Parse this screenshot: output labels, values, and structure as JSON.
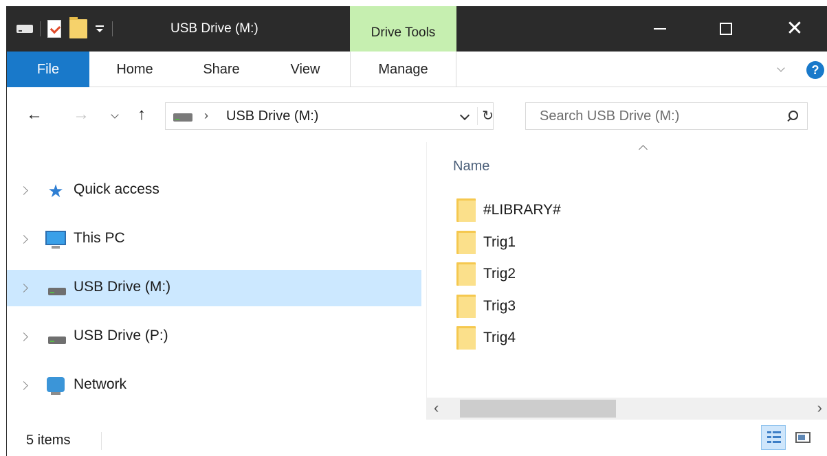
{
  "title_bar": {
    "title": "USB Drive (M:)",
    "context_tab": "Drive Tools"
  },
  "ribbon": {
    "tabs": [
      "File",
      "Home",
      "Share",
      "View",
      "Manage"
    ],
    "active_tab": "File",
    "help_label": "?"
  },
  "address_bar": {
    "path_segment": "USB Drive (M:)",
    "search_placeholder": "Search USB Drive (M:)"
  },
  "navigation_pane": {
    "items": [
      {
        "label": "Quick access",
        "icon": "quick-access-star-icon"
      },
      {
        "label": "This PC",
        "icon": "this-pc-icon"
      },
      {
        "label": "USB Drive (M:)",
        "icon": "usb-drive-icon",
        "selected": true
      },
      {
        "label": "USB Drive (P:)",
        "icon": "usb-drive-icon"
      },
      {
        "label": "Network",
        "icon": "network-icon"
      }
    ]
  },
  "content": {
    "column_header": "Name",
    "files": [
      {
        "name": "#LIBRARY#",
        "icon": "folder-icon"
      },
      {
        "name": "Trig1",
        "icon": "folder-icon"
      },
      {
        "name": "Trig2",
        "icon": "folder-icon"
      },
      {
        "name": "Trig3",
        "icon": "folder-icon"
      },
      {
        "name": "Trig4",
        "icon": "folder-icon"
      }
    ]
  },
  "status_bar": {
    "item_count": "5 items",
    "view": "details"
  },
  "colors": {
    "title_bar_bg": "#2b2b2b",
    "file_tab_bg": "#1979ca",
    "drive_tools_bg": "#c6efb0",
    "selection_bg": "#cce8ff",
    "folder_yellow": "#f5c84f"
  }
}
